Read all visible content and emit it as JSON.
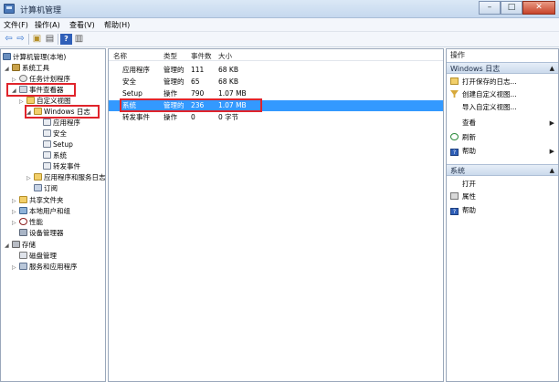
{
  "window": {
    "title": "计算机管理"
  },
  "menu": {
    "items": [
      "文件(F)",
      "操作(A)",
      "查看(V)",
      "帮助(H)"
    ]
  },
  "tree": {
    "items": [
      {
        "label": "计算机管理(本地)",
        "icon": "computer-icon"
      },
      {
        "label": "系统工具",
        "icon": "tools-icon"
      },
      {
        "label": "任务计划程序",
        "icon": "clock-icon"
      },
      {
        "label": "事件查看器",
        "icon": "event-viewer-icon"
      },
      {
        "label": "自定义视图",
        "icon": "folder-icon"
      },
      {
        "label": "Windows 日志",
        "icon": "folder-icon"
      },
      {
        "label": "应用程序",
        "icon": "log-icon"
      },
      {
        "label": "安全",
        "icon": "log-icon"
      },
      {
        "label": "Setup",
        "icon": "log-icon"
      },
      {
        "label": "系统",
        "icon": "log-icon"
      },
      {
        "label": "转发事件",
        "icon": "log-icon"
      },
      {
        "label": "应用程序和服务日志",
        "icon": "folder-icon"
      },
      {
        "label": "订阅",
        "icon": "subscription-icon"
      },
      {
        "label": "共享文件夹",
        "icon": "shared-folder-icon"
      },
      {
        "label": "本地用户和组",
        "icon": "users-icon"
      },
      {
        "label": "性能",
        "icon": "performance-icon"
      },
      {
        "label": "设备管理器",
        "icon": "device-manager-icon"
      },
      {
        "label": "存储",
        "icon": "storage-icon"
      },
      {
        "label": "磁盘管理",
        "icon": "disk-icon"
      },
      {
        "label": "服务和应用程序",
        "icon": "services-icon"
      }
    ]
  },
  "list": {
    "columns": [
      "名称",
      "类型",
      "事件数",
      "大小"
    ],
    "rows": [
      {
        "name": "应用程序",
        "type": "管理的",
        "count": "111",
        "size": "68 KB"
      },
      {
        "name": "安全",
        "type": "管理的",
        "count": "65",
        "size": "68 KB"
      },
      {
        "name": "Setup",
        "type": "操作",
        "count": "790",
        "size": "1.07 MB"
      },
      {
        "name": "系统",
        "type": "管理的",
        "count": "236",
        "size": "1.07 MB"
      },
      {
        "name": "转发事件",
        "type": "操作",
        "count": "0",
        "size": "0 字节"
      }
    ]
  },
  "actions": {
    "title": "操作",
    "sections": [
      {
        "header": "Windows 日志",
        "items": [
          {
            "label": "打开保存的日志...",
            "icon": "open-log-icon"
          },
          {
            "label": "创建自定义视图...",
            "icon": "filter-icon"
          },
          {
            "label": "导入自定义视图...",
            "icon": ""
          },
          {
            "label": "查看",
            "icon": "",
            "submenu": true
          },
          {
            "label": "刷新",
            "icon": "refresh-icon"
          },
          {
            "label": "帮助",
            "icon": "help-icon",
            "submenu": true
          }
        ]
      },
      {
        "header": "系统",
        "items": [
          {
            "label": "打开",
            "icon": ""
          },
          {
            "label": "属性",
            "icon": "properties-icon"
          },
          {
            "label": "帮助",
            "icon": "help-icon"
          }
        ]
      }
    ]
  },
  "colors": {
    "selection": "#3399ff",
    "highlight_border": "#e0242b"
  }
}
